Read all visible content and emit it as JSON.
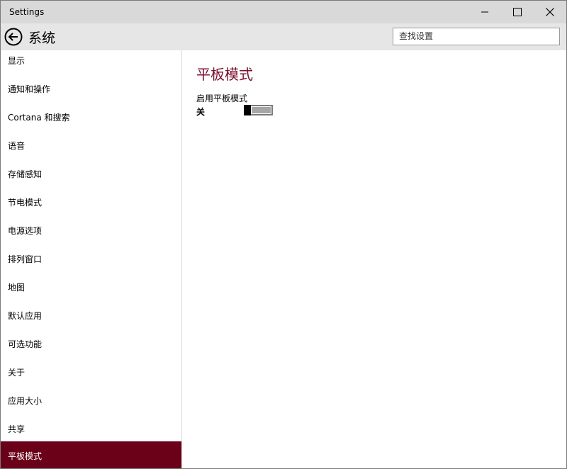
{
  "window": {
    "title": "Settings",
    "minimize_icon": "minimize-icon",
    "maximize_icon": "maximize-icon",
    "close_icon": "close-icon"
  },
  "header": {
    "back_icon": "back-arrow-icon",
    "title": "系统",
    "search_placeholder": "查找设置"
  },
  "sidebar": {
    "items": [
      {
        "label": "显示"
      },
      {
        "label": "通知和操作"
      },
      {
        "label": "Cortana 和搜索"
      },
      {
        "label": "语音"
      },
      {
        "label": "存储感知"
      },
      {
        "label": "节电模式"
      },
      {
        "label": "电源选项"
      },
      {
        "label": "排列窗口"
      },
      {
        "label": "地图"
      },
      {
        "label": "默认应用"
      },
      {
        "label": "可选功能"
      },
      {
        "label": "关于"
      },
      {
        "label": "应用大小"
      },
      {
        "label": "共享"
      },
      {
        "label": "平板模式"
      }
    ],
    "selected_index": 14,
    "selected_color": "#6b0019"
  },
  "main": {
    "title": "平板模式",
    "title_color": "#7a1230",
    "setting": {
      "label": "启用平板模式",
      "state_text": "关",
      "is_on": false
    }
  }
}
